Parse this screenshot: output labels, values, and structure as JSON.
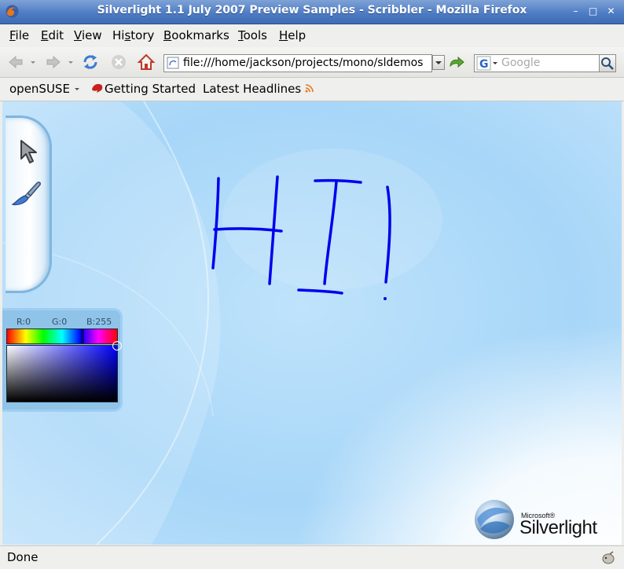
{
  "window": {
    "title": "Silverlight 1.1 July 2007 Preview Samples - Scribbler - Mozilla Firefox",
    "minimize_glyph": "–",
    "maximize_glyph": "□",
    "close_glyph": "✕"
  },
  "menubar": {
    "items": [
      {
        "accel": "F",
        "rest": "ile"
      },
      {
        "accel": "E",
        "rest": "dit"
      },
      {
        "accel": "V",
        "rest": "iew"
      },
      {
        "prefix": "Hi",
        "accel": "s",
        "rest": "tory"
      },
      {
        "accel": "B",
        "rest": "ookmarks"
      },
      {
        "accel": "T",
        "rest": "ools"
      },
      {
        "accel": "H",
        "rest": "elp"
      }
    ]
  },
  "navbar": {
    "url": "file:///home/jackson/projects/mono/sldemos",
    "search_placeholder": "Google"
  },
  "bookmarks": {
    "items": [
      "openSUSE",
      "Getting Started",
      "Latest Headlines"
    ]
  },
  "scribbler": {
    "color_labels": {
      "r": "R:0",
      "g": "G:0",
      "b": "B:255"
    },
    "ink_color": "#0000ee"
  },
  "logo": {
    "microsoft": "Microsoft®",
    "name": "Silverlight"
  },
  "status": {
    "text": "Done"
  }
}
